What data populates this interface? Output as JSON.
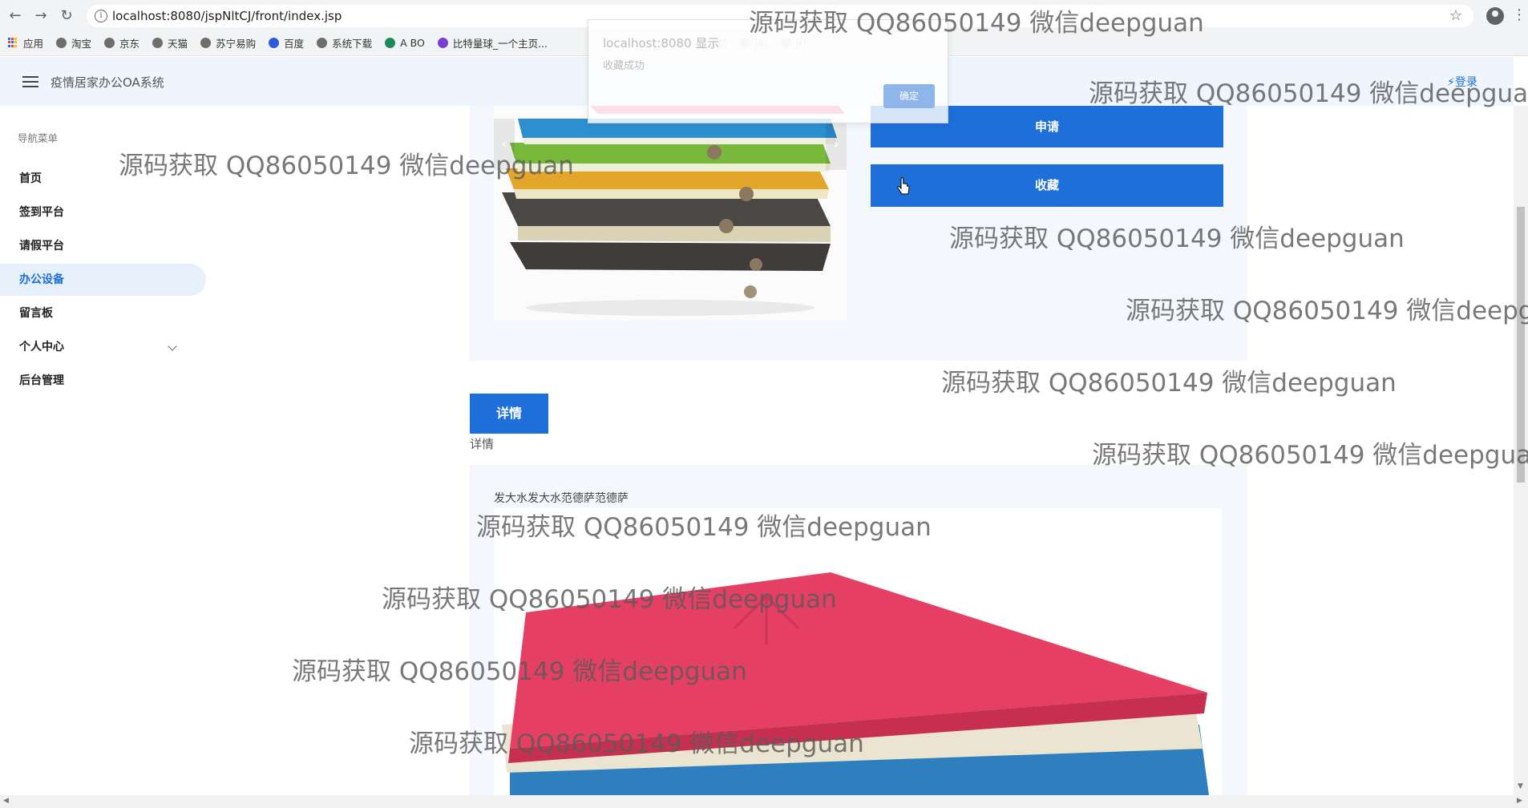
{
  "browser": {
    "url": "localhost:8080/jspNltCJ/front/index.jsp",
    "bookmarks": [
      {
        "label": "应用",
        "icon": "apps-grid-icon"
      },
      {
        "label": "淘宝",
        "icon": "globe-icon"
      },
      {
        "label": "京东",
        "icon": "globe-icon"
      },
      {
        "label": "天猫",
        "icon": "globe-icon"
      },
      {
        "label": "苏宁易购",
        "icon": "globe-icon"
      },
      {
        "label": "百度",
        "icon": "paw-icon"
      },
      {
        "label": "系统下载",
        "icon": "globe-icon"
      },
      {
        "label": "A BO",
        "icon": "leaf-icon"
      },
      {
        "label": "比特量球_一个主页...",
        "icon": "bit-icon"
      }
    ],
    "faded_bookmarks": [
      "s前",
      "j前",
      "jH"
    ]
  },
  "header": {
    "title": "疫情居家办公OA系统",
    "login": "⚡登录"
  },
  "sidebar": {
    "caption": "导航菜单",
    "items": [
      {
        "label": "首页",
        "active": false
      },
      {
        "label": "签到平台",
        "active": false
      },
      {
        "label": "请假平台",
        "active": false
      },
      {
        "label": "办公设备",
        "active": true
      },
      {
        "label": "留言板",
        "active": false
      },
      {
        "label": "个人中心",
        "active": false,
        "has_submenu": true
      },
      {
        "label": "后台管理",
        "active": false
      }
    ]
  },
  "product": {
    "apply_button": "申请",
    "favorite_button": "收藏",
    "detail_button": "详情",
    "detail_label": "详情",
    "second_item_name": "发大水发大水范德萨范德萨"
  },
  "alert": {
    "title": "localhost:8080 显示",
    "message": "收藏成功",
    "ok_button": "确定"
  },
  "watermark": {
    "text": "源码获取 QQ86050149 微信deepguan",
    "truncated_text": "源码获取 QQ86050149 微信deepgu"
  },
  "colors": {
    "accent": "#1e6fd9",
    "header_bg": "#eef5fd",
    "sidebar_active_bg": "#e6f0fb",
    "card_bg": "#f4f8fd"
  }
}
